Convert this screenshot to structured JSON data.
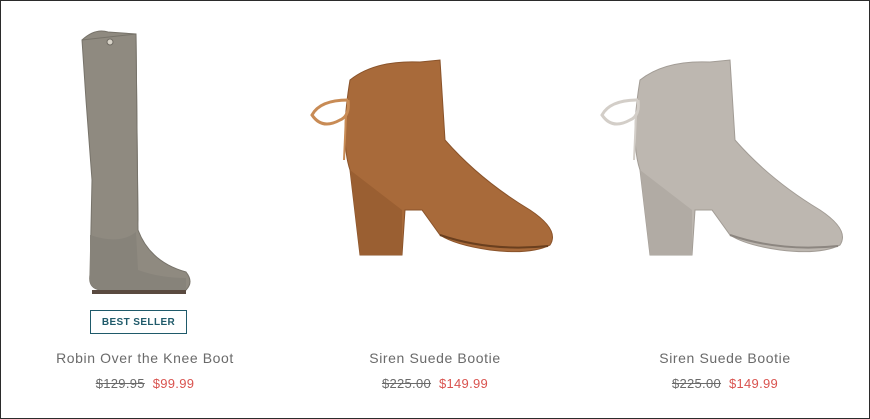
{
  "products": [
    {
      "name": "Robin Over the Knee Boot",
      "badge": "BEST SELLER",
      "original_price": "$129.95",
      "sale_price": "$99.99",
      "image_icon": "over-the-knee-boot",
      "color": "#8f8a80"
    },
    {
      "name": "Siren Suede Bootie",
      "original_price": "$225.00",
      "sale_price": "$149.99",
      "image_icon": "heeled-bootie",
      "color": "#a86a3a"
    },
    {
      "name": "Siren Suede Bootie",
      "original_price": "$225.00",
      "sale_price": "$149.99",
      "image_icon": "heeled-bootie",
      "color": "#bdb7b0"
    }
  ],
  "colors": {
    "badge_accent": "#1f5a6a",
    "sale_price": "#d9534f"
  }
}
